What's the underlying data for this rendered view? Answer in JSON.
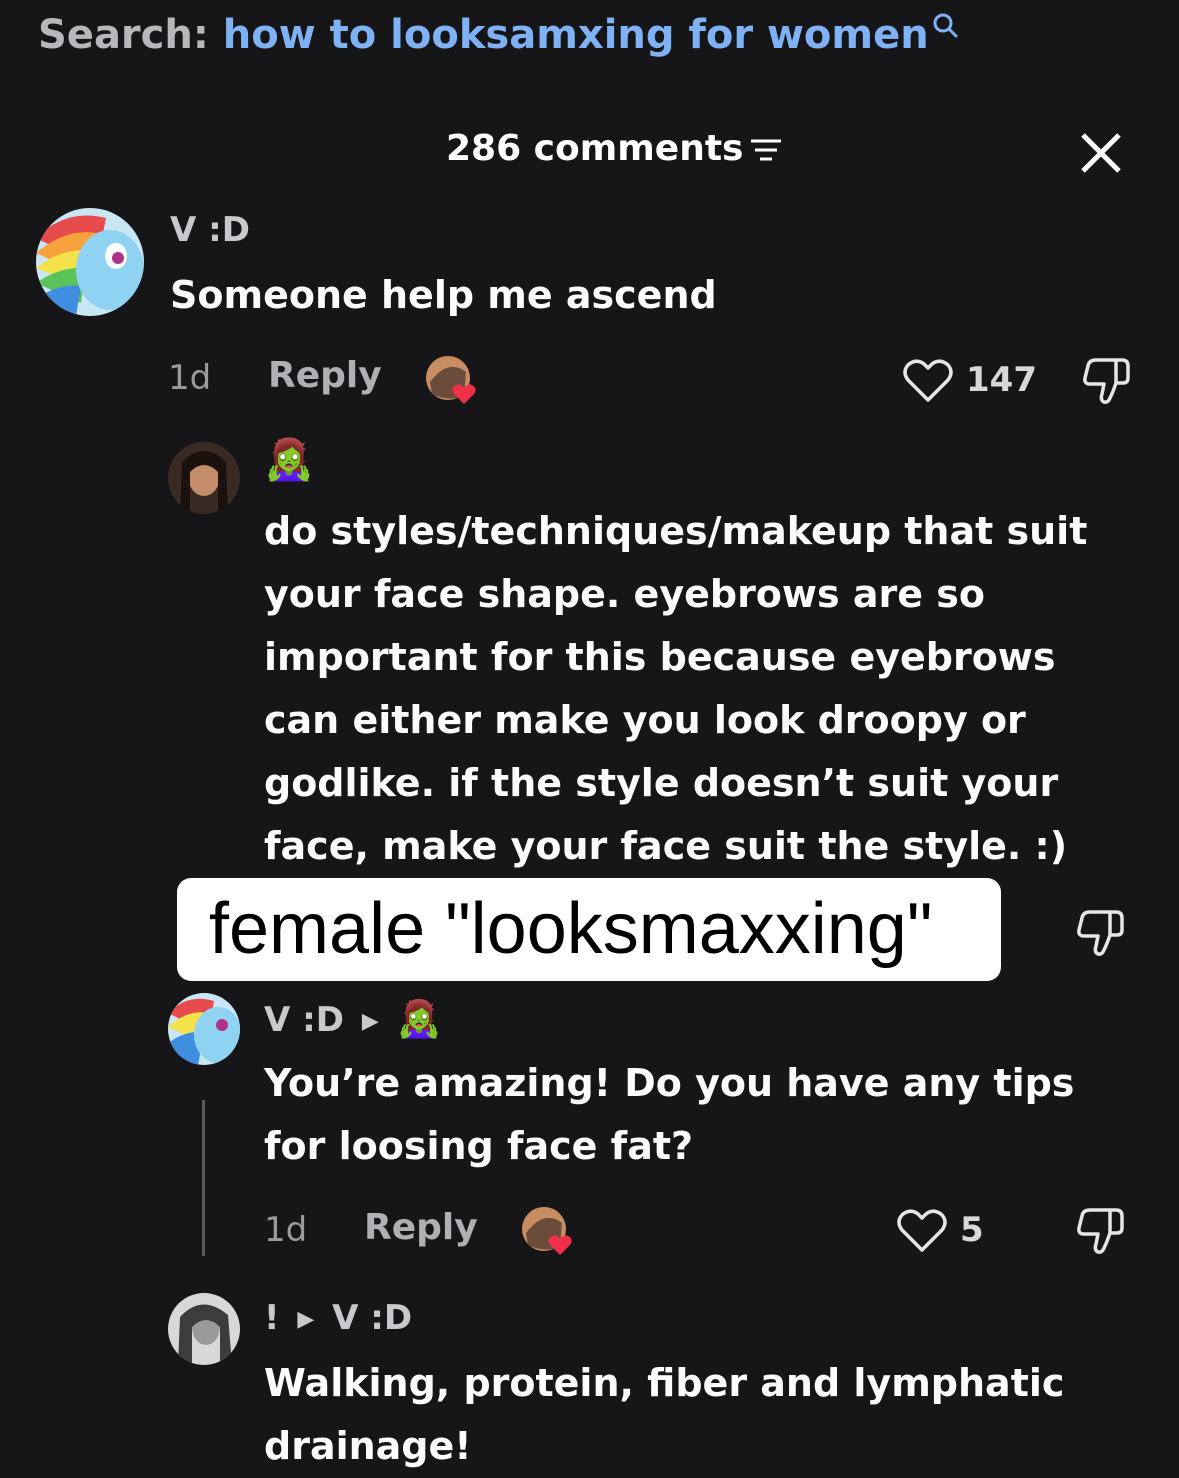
{
  "search": {
    "label": "Search:",
    "query": "how to looksamxing for women"
  },
  "comments_header": {
    "count_text": "286 comments"
  },
  "overlay_caption": "female \"looksmaxxing\"",
  "comments": [
    {
      "username": "V :D",
      "text": "Someone help me ascend",
      "age": "1d",
      "reply_label": "Reply",
      "likes": "147"
    },
    {
      "username_emoji": "🧟‍♀️",
      "text": "do styles/techniques/makeup that suit your face shape. eyebrows are so important for this because eyebrows can either make you look droopy or godlike. if the style doesn’t suit your face, make your face suit the style. :)"
    },
    {
      "username": "V :D",
      "reply_to_emoji": "🧟‍♀️",
      "text": "You’re amazing! Do you have any tips for loosing face fat?",
      "age": "1d",
      "reply_label": "Reply",
      "likes": "5"
    },
    {
      "username": "!",
      "reply_to": "V :D",
      "text": "Walking, protein, fiber and lymphatic drainage!"
    }
  ],
  "colors": {
    "background": "#161618",
    "search_query": "#7fb2f5",
    "heart_badge": "#f0304a"
  }
}
